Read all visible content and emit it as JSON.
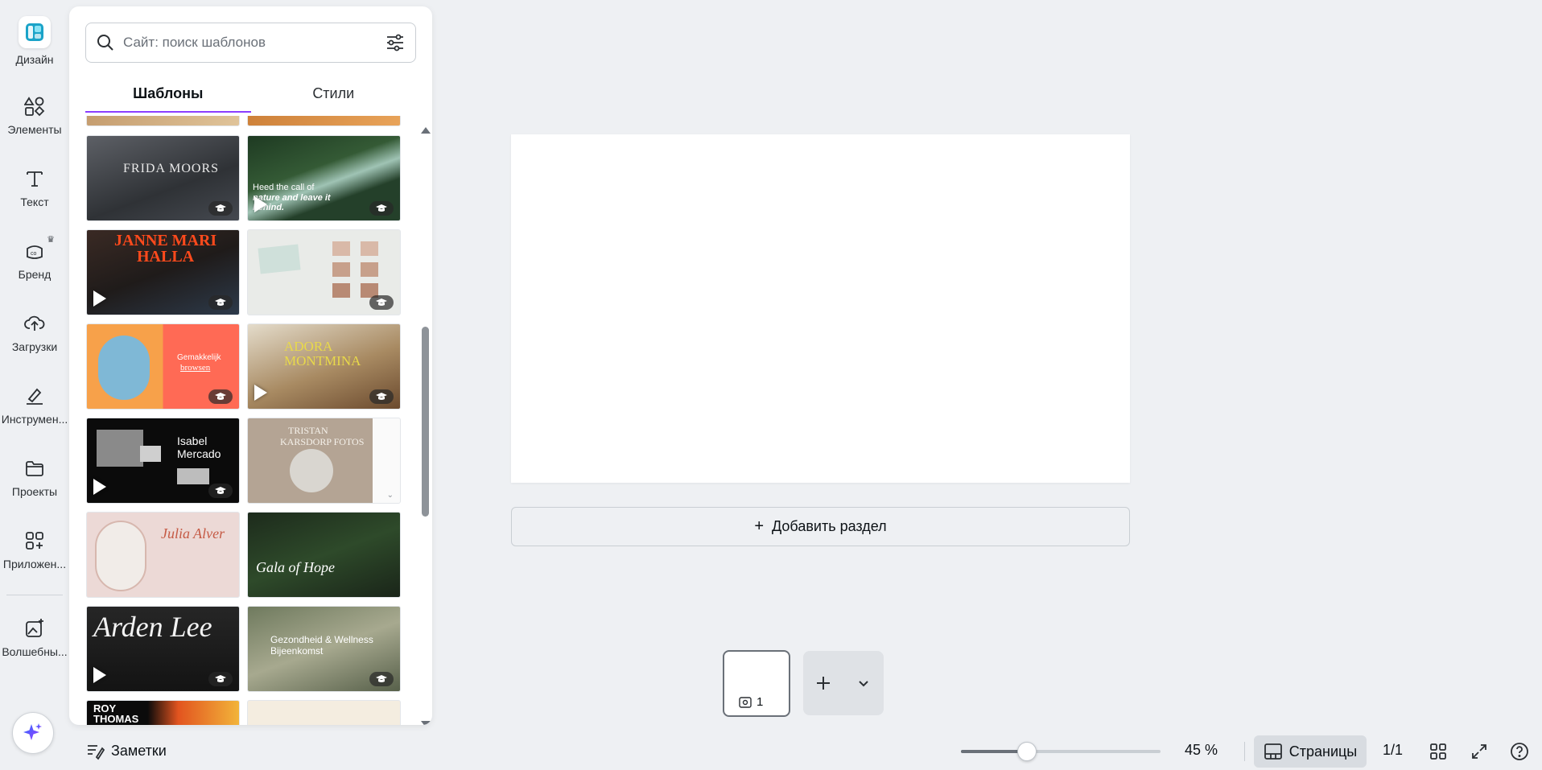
{
  "rail": {
    "items": [
      {
        "label": "Дизайн"
      },
      {
        "label": "Элементы"
      },
      {
        "label": "Текст"
      },
      {
        "label": "Бренд"
      },
      {
        "label": "Загрузки"
      },
      {
        "label": "Инструмен..."
      },
      {
        "label": "Проекты"
      },
      {
        "label": "Приложен..."
      },
      {
        "label": "Волшебны..."
      }
    ]
  },
  "panel": {
    "search_placeholder": "Сайт: поиск шаблонов",
    "tabs": [
      {
        "label": "Шаблоны"
      },
      {
        "label": "Стили"
      }
    ],
    "templates": [
      {
        "text1": "FRIDA MOORS",
        "text2": ""
      },
      {
        "text1": "Heed the call of",
        "text2": "nature and leave it behind."
      },
      {
        "text1": "JANNE MARI",
        "text2": "HALLA"
      },
      {
        "text1": "",
        "text2": ""
      },
      {
        "text1": "Gemakkelijk",
        "text2": "browsen"
      },
      {
        "text1": "ADORA",
        "text2": "MONTMINA"
      },
      {
        "text1": "Isabel",
        "text2": "Mercado"
      },
      {
        "text1": "TRISTAN",
        "text2": "KARSDORP FOTOS"
      },
      {
        "text1": "Julia Alver",
        "text2": ""
      },
      {
        "text1": "Gala of Hope",
        "text2": ""
      },
      {
        "text1": "Arden Lee",
        "text2": ""
      },
      {
        "text1": "Gezondheid & Wellness",
        "text2": "Bijeenkomst"
      },
      {
        "text1": "ROY",
        "text2": "THOMAS"
      },
      {
        "text1": "",
        "text2": ""
      }
    ]
  },
  "canvas": {
    "add_section_label": "Добавить раздел"
  },
  "page_strip": {
    "page_number": "1"
  },
  "bottom": {
    "notes_label": "Заметки",
    "zoom_value": "45 %",
    "zoom_level": 0.33,
    "pages_label": "Страницы",
    "page_count": "1/1"
  }
}
